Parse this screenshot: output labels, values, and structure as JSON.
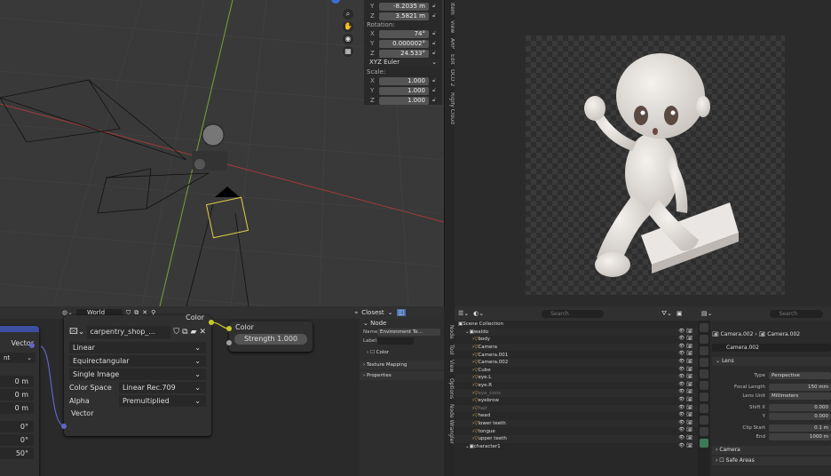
{
  "npanel": {
    "location_y": {
      "axis": "Y",
      "value": "-8.2035 m"
    },
    "location_z": {
      "axis": "Z",
      "value": "3.5821 m"
    },
    "rotation_label": "Rotation:",
    "rotation": [
      {
        "axis": "X",
        "value": "74°"
      },
      {
        "axis": "Y",
        "value": "0.000002°"
      },
      {
        "axis": "Z",
        "value": "24.533°"
      }
    ],
    "euler_mode": "XYZ Euler",
    "scale_label": "Scale:",
    "scale": [
      {
        "axis": "X",
        "value": "1.000"
      },
      {
        "axis": "Y",
        "value": "1.000"
      },
      {
        "axis": "Z",
        "value": "1.000"
      }
    ]
  },
  "viewport_tabs": [
    "Item",
    "View",
    "ARP",
    "Edit",
    "OCD 2",
    "Rigify Cloud"
  ],
  "node_editor": {
    "world_name": "World",
    "color_label": "Color",
    "image_name": "carpentry_shop_...",
    "interpolation": "Linear",
    "projection": "Equirectangular",
    "extension": "Single Image",
    "color_space_label": "Color Space",
    "color_space": "Linear Rec.709",
    "alpha_label": "Alpha",
    "alpha": "Premultiplied",
    "vector_label": "Vector",
    "bg_color_label": "Color",
    "strength_label": "Strength",
    "strength_value": "1.000",
    "left_vector": "Vector",
    "left_ent": "nt",
    "left_values": [
      "0 m",
      "0 m",
      "0 m",
      "0°",
      "0°",
      "50°"
    ],
    "snap_mode": "Closest"
  },
  "node_sidebar": {
    "section": "Node",
    "name_label": "Name:",
    "name_value": "Environment Te...",
    "label_label": "Label:",
    "color_row": "Color",
    "texture_mapping": "Texture Mapping",
    "properties": "Properties",
    "tabs": [
      "Node",
      "Tool",
      "View",
      "Options",
      "Node Wrangler"
    ]
  },
  "outliner": {
    "search_placeholder": "Search",
    "rows": [
      {
        "indent": 0,
        "label": "Scene Collection",
        "color": "#ddd"
      },
      {
        "indent": 1,
        "label": "waldo",
        "color": "#ddd"
      },
      {
        "indent": 2,
        "label": "body",
        "color": "#ddd"
      },
      {
        "indent": 2,
        "label": "Camera",
        "color": "#ddd"
      },
      {
        "indent": 2,
        "label": "Camera.001",
        "color": "#ddd"
      },
      {
        "indent": 2,
        "label": "Camera.002",
        "color": "#ddd"
      },
      {
        "indent": 2,
        "label": "Cube",
        "color": "#ddd"
      },
      {
        "indent": 2,
        "label": "eye.L",
        "color": "#ddd"
      },
      {
        "indent": 2,
        "label": "eye.R",
        "color": "#ddd"
      },
      {
        "indent": 2,
        "label": "eye_cons",
        "color": "#777"
      },
      {
        "indent": 2,
        "label": "eyebrow",
        "color": "#ddd"
      },
      {
        "indent": 2,
        "label": "hair",
        "color": "#777"
      },
      {
        "indent": 2,
        "label": "head",
        "color": "#ddd"
      },
      {
        "indent": 2,
        "label": "lower teeth",
        "color": "#ddd"
      },
      {
        "indent": 2,
        "label": "tongue",
        "color": "#ddd"
      },
      {
        "indent": 2,
        "label": "upper teeth",
        "color": "#ddd"
      },
      {
        "indent": 1,
        "label": "character1",
        "color": "#ddd"
      }
    ]
  },
  "properties": {
    "search_placeholder": "Search",
    "breadcrumb_a": "Camera.002",
    "breadcrumb_b": "Camera.002",
    "data_name": "Camera.002",
    "lens_section": "Lens",
    "type_label": "Type",
    "type_value": "Perspective",
    "focal_label": "Focal Length",
    "focal_value": "150 mm",
    "lens_unit_label": "Lens Unit",
    "lens_unit_value": "Millimeters",
    "shift_x_label": "Shift X",
    "shift_x_value": "0.000",
    "shift_y_label": "Y",
    "shift_y_value": "0.000",
    "clip_start_label": "Clip Start",
    "clip_start_value": "0.1 m",
    "clip_end_label": "End",
    "clip_end_value": "1000 m",
    "camera_section": "Camera",
    "safe_areas_section": "Safe Areas"
  }
}
